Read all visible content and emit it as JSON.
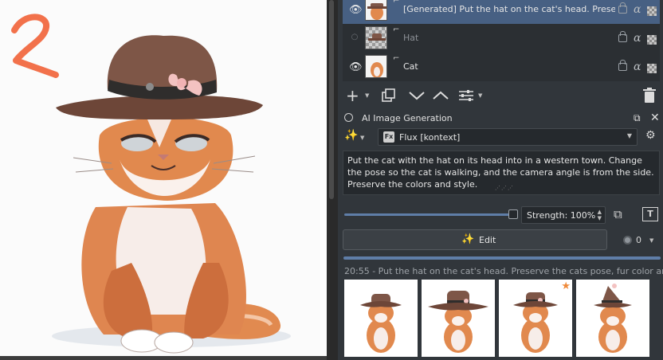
{
  "layers": [
    {
      "name": "[Generated] Put the hat on the cat's head. Preser...",
      "visible": true,
      "selected": true,
      "icons": [
        "eye-icon",
        "link-icon",
        "lock-icon",
        "alpha-icon",
        "blend-icon"
      ]
    },
    {
      "name": "Hat",
      "visible": false,
      "selected": false,
      "icons": [
        "eye-off-icon",
        "link-icon",
        "lock-icon",
        "alpha-icon",
        "blend-icon"
      ]
    },
    {
      "name": "Cat",
      "visible": true,
      "selected": false,
      "icons": [
        "eye-icon",
        "link-icon",
        "lock-icon",
        "alpha-icon",
        "blend-icon"
      ]
    }
  ],
  "layer_toolbar": {
    "icons": [
      "add-layer-icon",
      "duplicate-layer-icon",
      "move-down-icon",
      "move-up-icon",
      "layer-properties-icon",
      "delete-layer-icon"
    ]
  },
  "dock": {
    "title": "AI Image Generation"
  },
  "model": {
    "selected": "Flux [kontext]",
    "badge": "Fx"
  },
  "prompt": {
    "text": "Put the cat with the hat on its head into in a western town. Change the pose so the cat is walking, and the camera angle is from the side. Preserve the colors and style."
  },
  "strength": {
    "label": "Strength: 100%",
    "value": 1.0
  },
  "edit_button": {
    "label": "Edit"
  },
  "queue": {
    "count": "0"
  },
  "progress": {
    "value": 1.0
  },
  "history": {
    "label": "20:55 - Put the hat on the cat's head. Preserve the cats pose, fur color and sr"
  },
  "results": [
    {
      "hat": "cowboy",
      "starred": false
    },
    {
      "hat": "wide-brim",
      "starred": false
    },
    {
      "hat": "cowboy",
      "starred": true
    },
    {
      "hat": "witch",
      "starred": false
    }
  ],
  "colors": {
    "accent": "#476083",
    "panel": "#31363b",
    "annotation": "#f2714b",
    "hat": "#7b5546",
    "fur": "#e0894e"
  }
}
